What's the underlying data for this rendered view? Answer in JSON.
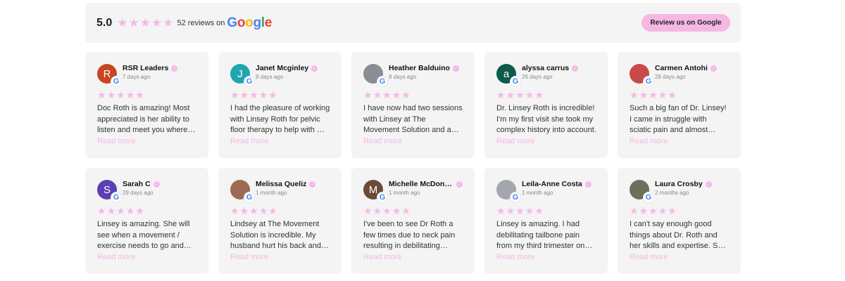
{
  "header": {
    "rating": "5.0",
    "star_count": 5,
    "reviews_text": "52 reviews",
    "on_text": "on",
    "logo_text": "Google",
    "button_label": "Review us on Google"
  },
  "colors": {
    "accent": "#f5b8e4",
    "card_bg": "#f4f4f4"
  },
  "reviews": [
    {
      "name": "RSR Leaders",
      "date": "7 days ago",
      "initial": "R",
      "avatar_color": "#c8461f",
      "rating": 5,
      "text": "Doc Roth is amazing! Most appreciated is her ability to listen and meet you where you are.",
      "read_more": "Read more"
    },
    {
      "name": "Janet Mcginley",
      "date": "8 days ago",
      "initial": "J",
      "avatar_color": "#1fa7b0",
      "rating": 5,
      "text": "I had the pleasure of working with Linsey Roth for pelvic floor therapy to help with my recovery.",
      "read_more": "Read more"
    },
    {
      "name": "Heather Balduino",
      "date": "8 days ago",
      "initial": "",
      "avatar_color": "#8a8d94",
      "rating": 5,
      "text": "I have now had two sessions with Linsey at The Movement Solution and am already feeling better.",
      "read_more": "Read more"
    },
    {
      "name": "alyssa carrus",
      "date": "26 days ago",
      "initial": "a",
      "avatar_color": "#0e5a4b",
      "rating": 5,
      "text": "Dr. Linsey Roth is incredible! I'm my first visit she took my complex history into account.",
      "read_more": "Read more"
    },
    {
      "name": "Carmen Antohi",
      "date": "28 days ago",
      "initial": "",
      "avatar_color": "#c94a4a",
      "rating": 5,
      "text": "Such a big fan of Dr. Linsey! I came in struggle with sciatic pain and almost immediately felt relief.",
      "read_more": "Read more"
    },
    {
      "name": "Sarah C",
      "date": "29 days ago",
      "initial": "S",
      "avatar_color": "#5b3fb5",
      "rating": 5,
      "text": "Linsey is amazing. She will see when a movement / exercise needs to go and adjust accordingly.",
      "read_more": "Read more"
    },
    {
      "name": "Melissa Queliz",
      "date": "1 month ago",
      "initial": "",
      "avatar_color": "#9b6b55",
      "rating": 5,
      "text": "Lindsey at The Movement Solution is incredible. My husband hurt his back and she helped him.",
      "read_more": "Read more"
    },
    {
      "name": "Michelle McDonough",
      "date": "1 month ago",
      "initial": "M",
      "avatar_color": "#6b4a3a",
      "rating": 5,
      "text": "I've been to see Dr Roth a few times due to neck pain resulting in debilitating headaches.",
      "read_more": "Read more"
    },
    {
      "name": "Leila-Anne Costa",
      "date": "1 month ago",
      "initial": "",
      "avatar_color": "#a3a7ad",
      "rating": 5,
      "text": "Linsey is amazing. I had debilitating tailbone pain from my third trimester on and she helped.",
      "read_more": "Read more"
    },
    {
      "name": "Laura Crosby",
      "date": "2 months ago",
      "initial": "",
      "avatar_color": "#6d6f5a",
      "rating": 5,
      "text": "I can't say enough good things about Dr. Roth and her skills and expertise. She is wonderful.",
      "read_more": "Read more"
    }
  ]
}
